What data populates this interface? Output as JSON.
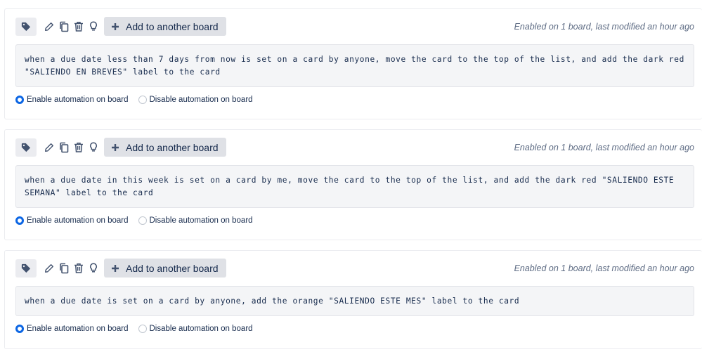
{
  "rules": [
    {
      "add_board_label": "Add to another board",
      "meta": "Enabled on 1 board, last modified an hour ago",
      "description": "when a due date less than 7 days from now is set on a card by anyone, move the card to the top of the list, and add the dark red \"SALIENDO EN BREVES\" label to the card",
      "enable_label": "Enable automation on board",
      "disable_label": "Disable automation on board",
      "selected": "enable"
    },
    {
      "add_board_label": "Add to another board",
      "meta": "Enabled on 1 board, last modified an hour ago",
      "description": "when a due date in this week is set on a card by me, move the card to the top of the list, and add the dark red \"SALIENDO ESTE SEMANA\" label to the card",
      "enable_label": "Enable automation on board",
      "disable_label": "Disable automation on board",
      "selected": "enable"
    },
    {
      "add_board_label": "Add to another board",
      "meta": "Enabled on 1 board, last modified an hour ago",
      "description": "when a due date is set on a card by anyone, add the orange \"SALIENDO ESTE MES\" label to the card",
      "enable_label": "Enable automation on board",
      "disable_label": "Disable automation on board",
      "selected": "enable"
    }
  ],
  "icons": {
    "tag": "tag-icon",
    "edit": "pencil-icon",
    "copy": "copy-icon",
    "delete": "trash-icon",
    "idea": "lightbulb-icon",
    "add": "plus-icon"
  },
  "colors": {
    "radio_selected": "#0c66e4",
    "button_bg": "#dfe1e6",
    "description_bg": "#f4f5f7",
    "meta_text": "#5e6c84"
  }
}
